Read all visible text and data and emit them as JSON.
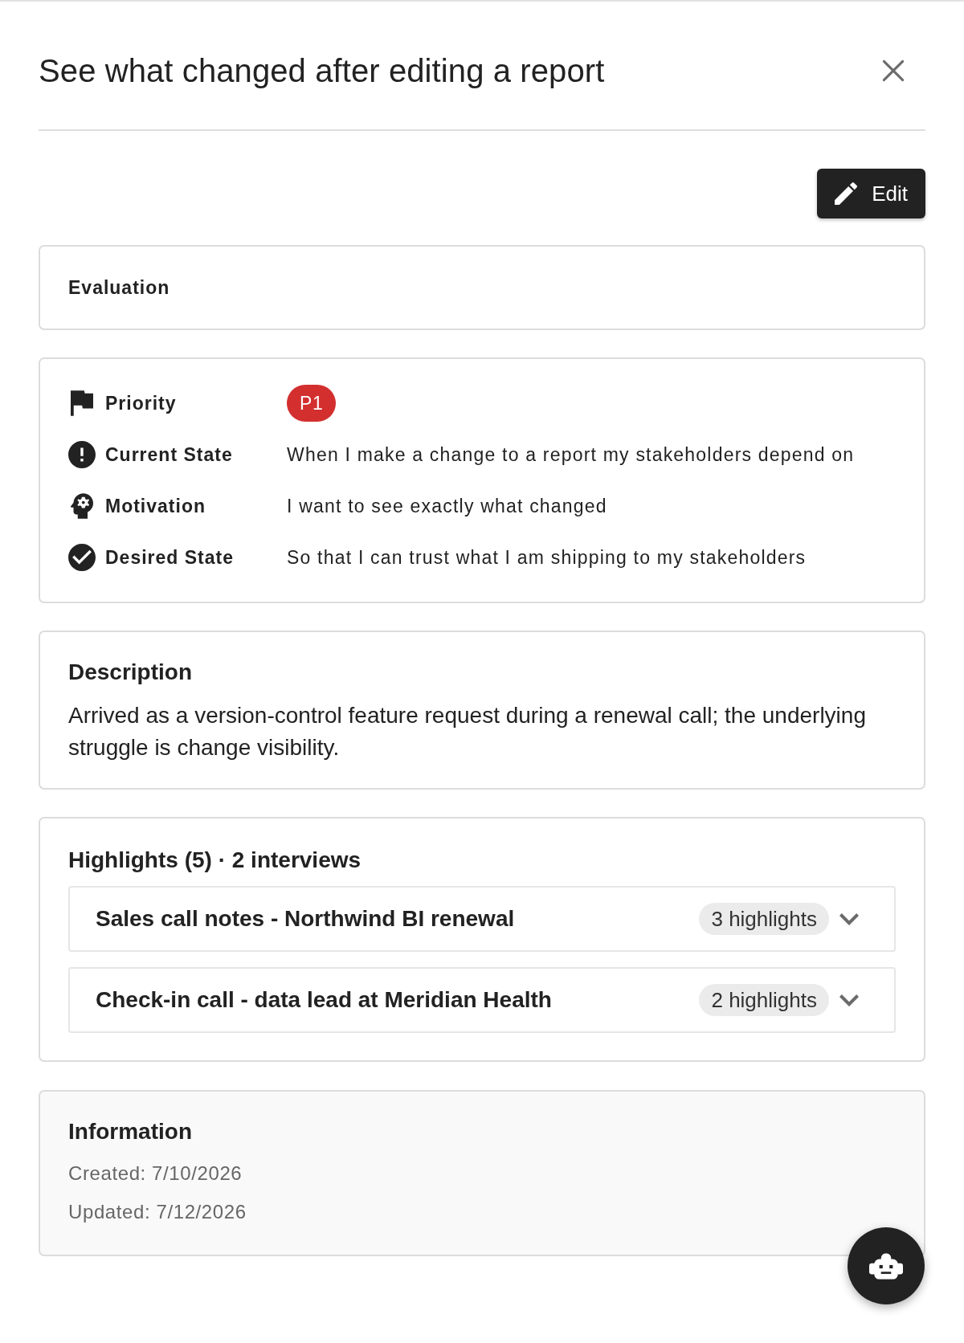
{
  "dialog": {
    "title": "See what changed after editing a report"
  },
  "actions": {
    "edit": "Edit"
  },
  "evaluation": {
    "title": "Evaluation"
  },
  "fields": [
    {
      "kind": "badge",
      "label": "Priority",
      "value": "P1"
    },
    {
      "kind": "text",
      "label": "Current State",
      "value": "When I make a change to a report my stakeholders depend on"
    },
    {
      "kind": "text",
      "label": "Motivation",
      "value": "I want to see exactly what changed"
    },
    {
      "kind": "text",
      "label": "Desired State",
      "value": "So that I can trust what I am shipping to my stakeholders"
    }
  ],
  "description": {
    "title": "Description",
    "text": "Arrived as a version-control feature request during a renewal call; the underlying struggle is change visibility."
  },
  "highlights": {
    "title": "Highlights (5) · 2 interviews",
    "items": [
      {
        "title": "Sales call notes - Northwind BI renewal",
        "count": "3 highlights",
        "expanded": false
      },
      {
        "title": "Check-in call - data lead at Meridian Health",
        "count": "2 highlights",
        "expanded": false
      }
    ]
  },
  "information": {
    "title": "Information",
    "lines": [
      "Created: 7/10/2026",
      "Updated: 7/12/2026"
    ]
  }
}
